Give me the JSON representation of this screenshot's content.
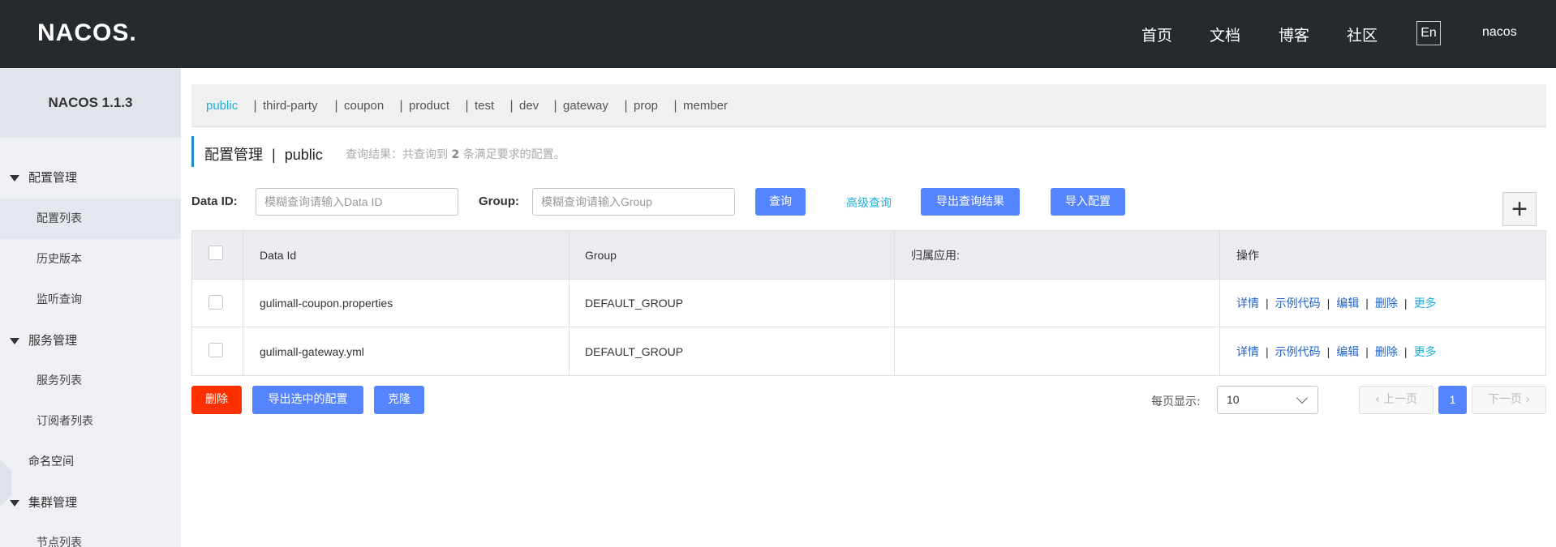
{
  "header": {
    "logo": "NACOS.",
    "nav": [
      "首页",
      "文档",
      "博客",
      "社区"
    ],
    "lang": "En",
    "user": "nacos"
  },
  "sidebar": {
    "version": "NACOS 1.1.3",
    "groups": [
      {
        "label": "配置管理",
        "items": [
          "配置列表",
          "历史版本",
          "监听查询"
        ]
      },
      {
        "label": "服务管理",
        "items": [
          "服务列表",
          "订阅者列表"
        ]
      },
      {
        "label": "命名空间"
      },
      {
        "label": "集群管理",
        "items": [
          "节点列表"
        ]
      }
    ]
  },
  "namespaces": [
    "public",
    "third-party",
    "coupon",
    "product",
    "test",
    "dev",
    "gateway",
    "prop",
    "member"
  ],
  "namespace_sep": "|",
  "title": {
    "main": "配置管理",
    "sep": "|",
    "ns": "public",
    "result_prefix": "查询结果：共查询到",
    "result_count": "2",
    "result_suffix": "条满足要求的配置。"
  },
  "search": {
    "dataid_label": "Data ID:",
    "dataid_placeholder": "模糊查询请输入Data ID",
    "group_label": "Group:",
    "group_placeholder": "模糊查询请输入Group",
    "query_btn": "查询",
    "advanced": "高级查询",
    "export_result": "导出查询结果",
    "import": "导入配置",
    "add": "+"
  },
  "table": {
    "headers": [
      "Data Id",
      "Group",
      "归属应用:",
      "操作"
    ],
    "rows": [
      {
        "dataid": "gulimall-coupon.properties",
        "group": "DEFAULT_GROUP",
        "app": ""
      },
      {
        "dataid": "gulimall-gateway.yml",
        "group": "DEFAULT_GROUP",
        "app": ""
      }
    ],
    "ops": [
      "详情",
      "示例代码",
      "编辑",
      "删除",
      "更多"
    ]
  },
  "bottom": {
    "delete": "删除",
    "export_selected": "导出选中的配置",
    "clone": "克隆",
    "page_size_label": "每页显示:",
    "page_size": "10",
    "prev": "上一页",
    "page": "1",
    "next": "下一页"
  },
  "colors": {
    "header_bg": "#252a2f",
    "primary": "#5584ff",
    "danger": "#ff3000",
    "link": "#1ab0d8"
  }
}
